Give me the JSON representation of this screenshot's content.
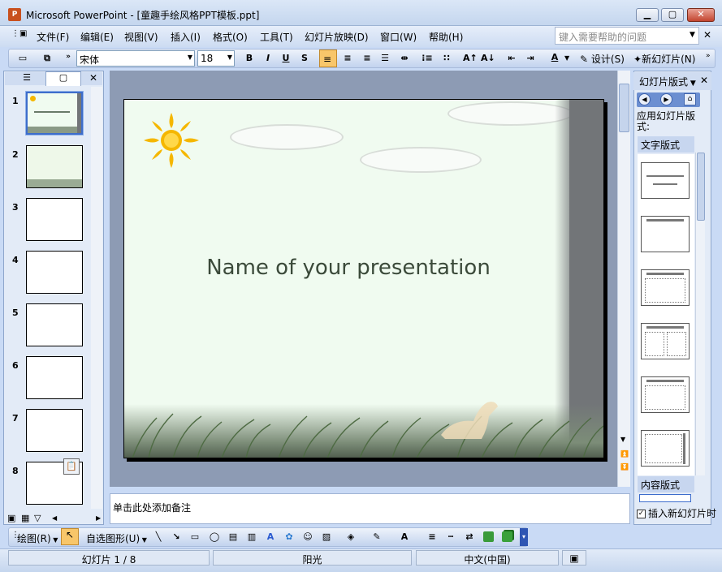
{
  "window": {
    "title": "Microsoft PowerPoint - [童趣手绘风格PPT模板.ppt]",
    "app_icon": "P",
    "minimize": "▁",
    "maximize": "▢",
    "close": "✕"
  },
  "menu": {
    "items": [
      "文件(F)",
      "编辑(E)",
      "视图(V)",
      "插入(I)",
      "格式(O)",
      "工具(T)",
      "幻灯片放映(D)",
      "窗口(W)",
      "帮助(H)"
    ],
    "help_placeholder": "键入需要帮助的问题"
  },
  "toolbar": {
    "font": "宋体",
    "size": "18",
    "bold": "B",
    "italic": "I",
    "underline": "U",
    "shadow": "S",
    "font_color": "A",
    "design_label": "设计(S)",
    "new_slide_label": "新幻灯片(N)"
  },
  "slides_panel": {
    "numbers": [
      "1",
      "2",
      "3",
      "4",
      "5",
      "6",
      "7",
      "8"
    ]
  },
  "slide": {
    "title": "Name of your presentation"
  },
  "notes": {
    "placeholder": "单击此处添加备注"
  },
  "task_pane": {
    "header": "幻灯片版式",
    "subtitle": "应用幻灯片版式:",
    "section_text": "文字版式",
    "section_content": "内容版式",
    "insert_new_label": "插入新幻灯片时"
  },
  "drawing_toolbar": {
    "draw_label": "绘图(R)",
    "autoshapes_label": "自选图形(U)"
  },
  "status": {
    "slide_info": "幻灯片 1 / 8",
    "design_name": "阳光",
    "language": "中文(中国)"
  },
  "colors": {
    "accent": "#3d6dcc",
    "slide_bg": "#f0fbf0",
    "sun": "#f5b700"
  }
}
